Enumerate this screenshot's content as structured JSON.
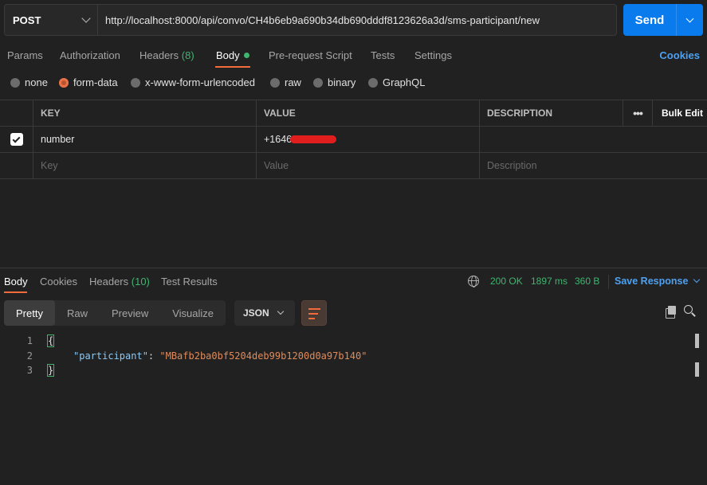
{
  "request": {
    "method": "POST",
    "url": "http://localhost:8000/api/convo/CH4b6eb9a690b34db690dddf8123626a3d/sms-participant/new",
    "send_label": "Send"
  },
  "tabs": {
    "params": "Params",
    "authorization": "Authorization",
    "headers": "Headers",
    "headers_count": "(8)",
    "body": "Body",
    "prerequest": "Pre-request Script",
    "tests": "Tests",
    "settings": "Settings",
    "cookies": "Cookies"
  },
  "body_types": {
    "selected": "form-data",
    "none": "none",
    "form_data": "form-data",
    "urlencoded": "x-www-form-urlencoded",
    "raw": "raw",
    "binary": "binary",
    "graphql": "GraphQL"
  },
  "kv_table": {
    "headers": {
      "key": "KEY",
      "value": "VALUE",
      "description": "DESCRIPTION",
      "bulk_edit": "Bulk Edit"
    },
    "rows": [
      {
        "checked": true,
        "key": "number",
        "value": "+1646",
        "description": ""
      }
    ],
    "placeholders": {
      "key": "Key",
      "value": "Value",
      "description": "Description"
    }
  },
  "response_tabs": {
    "body": "Body",
    "cookies": "Cookies",
    "headers": "Headers",
    "headers_count": "(10)",
    "test_results": "Test Results"
  },
  "response_status": {
    "status": "200 OK",
    "time": "1897 ms",
    "size": "360 B",
    "save_label": "Save Response"
  },
  "view_modes": {
    "selected": "Pretty",
    "pretty": "Pretty",
    "raw": "Raw",
    "preview": "Preview",
    "visualize": "Visualize",
    "format": "JSON"
  },
  "response_body": {
    "line_numbers": [
      "1",
      "2",
      "3"
    ],
    "open_brace": "{",
    "key": "\"participant\"",
    "colon": ": ",
    "value": "\"MBafb2ba0bf5204deb99b1200d0a97b140\"",
    "close_brace": "}"
  },
  "colors": {
    "accent": "#f26b3a",
    "primary": "#097bed",
    "success": "#3fb56f",
    "link": "#4ea0f0",
    "background": "#212121"
  },
  "icons": [
    "chevron-down-icon",
    "checkbox-icon",
    "more-icon",
    "globe-icon",
    "wrap-lines-icon",
    "copy-icon",
    "search-icon"
  ]
}
